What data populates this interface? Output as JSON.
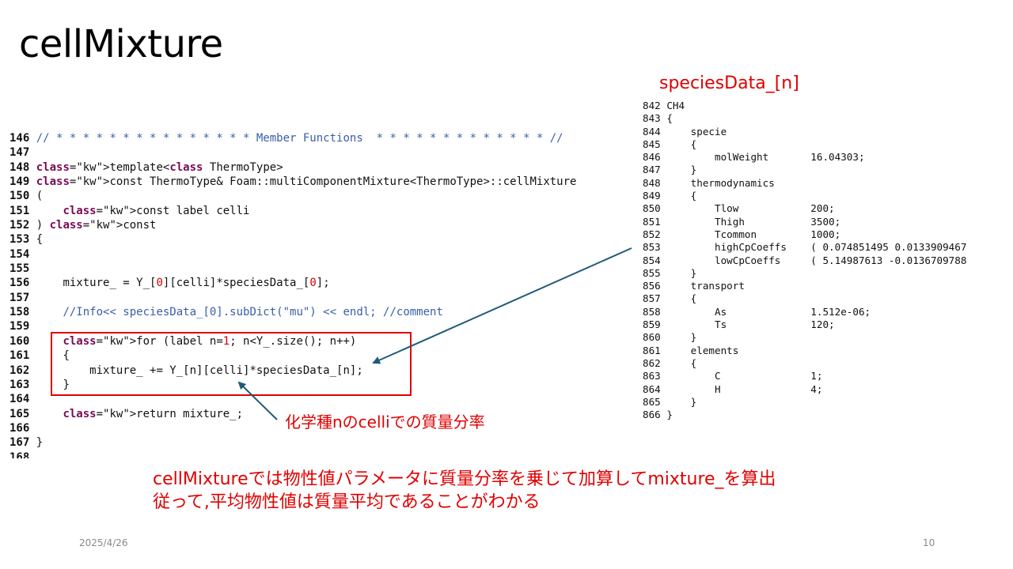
{
  "slide": {
    "title": "cellMixture",
    "species_title": "speciesData_[n]",
    "annotation": "化学種nのcelliでの質量分率",
    "summary_line1": "cellMixtureでは物性値パラメータに質量分率を乗じて加算してmixture_を算出",
    "summary_line2": "従って,平均物性値は質量平均であることがわかる",
    "date": "2025/4/26",
    "page_number": "10"
  },
  "code_lines": [
    {
      "n": "146",
      "text": "// * * * * * * * * * * * * * * * Member Functions  * * * * * * * * * * * * * //"
    },
    {
      "n": "147",
      "text": ""
    },
    {
      "n": "148",
      "text": "template<class ThermoType>"
    },
    {
      "n": "149",
      "text": "const ThermoType& Foam::multiComponentMixture<ThermoType>::cellMixture"
    },
    {
      "n": "150",
      "text": "("
    },
    {
      "n": "151",
      "text": "    const label celli"
    },
    {
      "n": "152",
      "text": ") const"
    },
    {
      "n": "153",
      "text": "{"
    },
    {
      "n": "154",
      "text": ""
    },
    {
      "n": "155",
      "text": ""
    },
    {
      "n": "156",
      "text": "    mixture_ = Y_[0][celli]*speciesData_[0];"
    },
    {
      "n": "157",
      "text": ""
    },
    {
      "n": "158",
      "text": "    //Info<< speciesData_[0].subDict(\"mu\") << endl; //comment"
    },
    {
      "n": "159",
      "text": ""
    },
    {
      "n": "160",
      "text": "    for (label n=1; n<Y_.size(); n++)"
    },
    {
      "n": "161",
      "text": "    {"
    },
    {
      "n": "162",
      "text": "        mixture_ += Y_[n][celli]*speciesData_[n];"
    },
    {
      "n": "163",
      "text": "    }"
    },
    {
      "n": "164",
      "text": ""
    },
    {
      "n": "165",
      "text": "    return mixture_;"
    },
    {
      "n": "166",
      "text": ""
    },
    {
      "n": "167",
      "text": "}"
    },
    {
      "n": "168",
      "text": ""
    }
  ],
  "species_lines": [
    "842 CH4",
    "843 {",
    "844     specie",
    "845     {",
    "846         molWeight       16.04303;",
    "847     }",
    "848     thermodynamics",
    "849     {",
    "850         Tlow            200;",
    "851         Thigh           3500;",
    "852         Tcommon         1000;",
    "853         highCpCoeffs    ( 0.074851495 0.0133909467",
    "854         lowCpCoeffs     ( 5.14987613 -0.0136709788",
    "855     }",
    "856     transport",
    "857     {",
    "858         As              1.512e-06;",
    "859         Ts              120;",
    "860     }",
    "861     elements",
    "862     {",
    "863         C               1;",
    "864         H               4;",
    "865     }",
    "866 }"
  ],
  "colors": {
    "accent_red": "#e00000",
    "arrow": "#1f5a78",
    "keyword": "#7a0a55",
    "comment": "#3a5ea8"
  }
}
